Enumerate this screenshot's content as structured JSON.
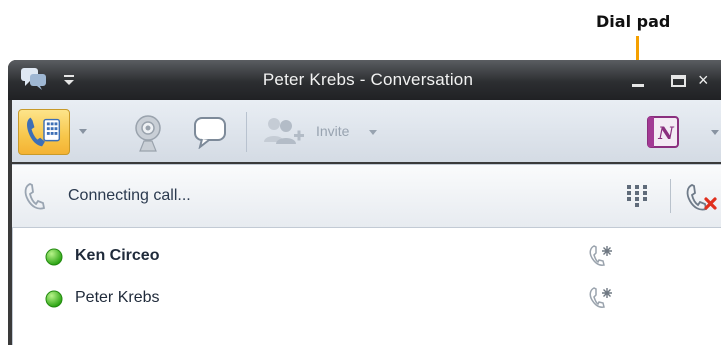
{
  "callout": {
    "label": "Dial pad",
    "color": "#f5a000"
  },
  "window": {
    "title": "Peter Krebs - Conversation",
    "buttons": {
      "minimize": "minimize-icon",
      "maximize": "maximize-icon",
      "close": "×"
    }
  },
  "toolbar": {
    "invite_label": "Invite",
    "accent": "#f7c64a"
  },
  "callbar": {
    "status": "Connecting call..."
  },
  "participants": [
    {
      "name": "Ken Circeo",
      "bold": true,
      "presence_color": "#3fbf1f"
    },
    {
      "name": "Peter Krebs",
      "bold": false,
      "presence_color": "#3fbf1f"
    }
  ]
}
